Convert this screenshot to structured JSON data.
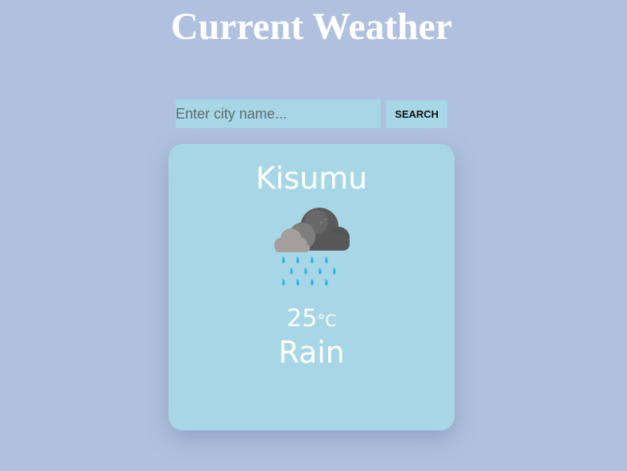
{
  "header": {
    "title": "Current Weather"
  },
  "search": {
    "placeholder": "Enter city name...",
    "value": "",
    "button_label": "SEARCH"
  },
  "weather": {
    "city": "Kisumu",
    "temperature": "25",
    "unit": "°C",
    "condition": "Rain",
    "icon": "rain-cloud-icon"
  },
  "colors": {
    "background": "#b0c1df",
    "card": "#a7d7e6",
    "text": "#ffffff",
    "raindrop": "#29b6e6"
  }
}
